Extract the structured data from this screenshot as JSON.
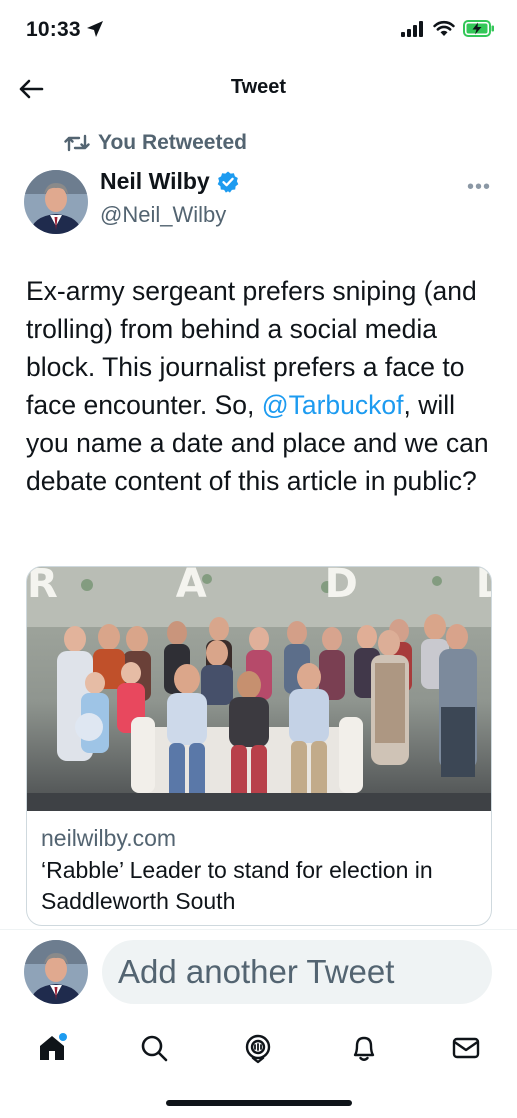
{
  "status_bar": {
    "time": "10:33"
  },
  "nav": {
    "title": "Tweet"
  },
  "tweet": {
    "retweet_context": "You Retweeted",
    "author_name": "Neil Wilby",
    "author_handle": "@Neil_Wilby",
    "text_before": "Ex-army sergeant prefers sniping (and trolling) from behind a social media block. This journalist prefers a face to face encounter. So, ",
    "mention": "@Tarbuckof",
    "text_after": ", will you name a date and place and we can debate content of this article in public?",
    "card": {
      "image_sign_letters": "R A D D L E",
      "domain": "neilwilby.com",
      "title": "‘Rabble’ Leader to stand for election in Saddleworth South"
    }
  },
  "compose": {
    "placeholder": "Add another Tweet"
  },
  "colors": {
    "accent": "#1d9bf0",
    "verified": "#1d9bf0",
    "battery": "#34c759",
    "text": "#0f1419",
    "muted": "#536471"
  },
  "icons": [
    "location-arrow-icon",
    "signal-icon",
    "wifi-icon",
    "battery-charging-icon",
    "back-arrow-icon",
    "retweet-icon",
    "verified-badge-icon",
    "more-icon",
    "home-icon",
    "search-icon",
    "spaces-icon",
    "notifications-icon",
    "messages-icon"
  ]
}
